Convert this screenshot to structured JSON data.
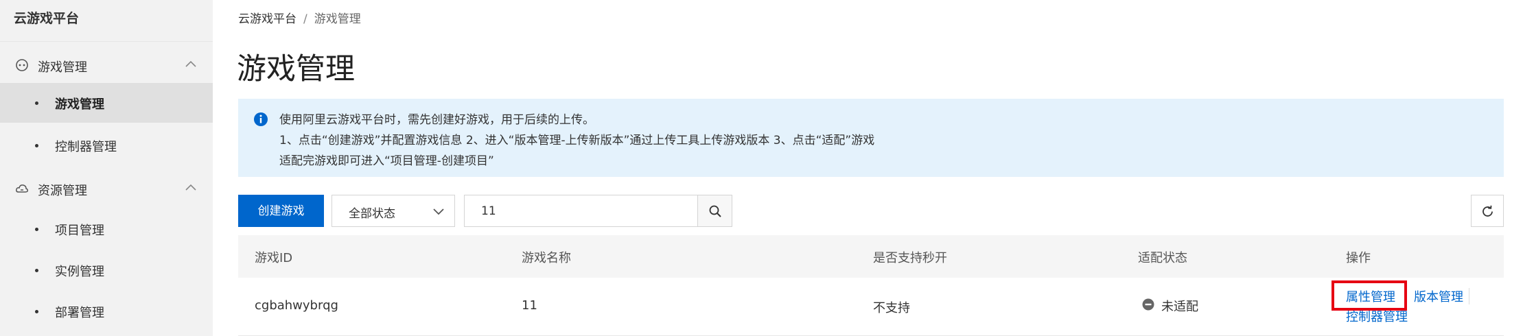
{
  "sidebar": {
    "brand": "云游戏平台",
    "groups": [
      {
        "label": "游戏管理",
        "icon": "gamepad-icon",
        "items": [
          {
            "label": "游戏管理",
            "active": true
          },
          {
            "label": "控制器管理",
            "active": false
          }
        ]
      },
      {
        "label": "资源管理",
        "icon": "cloud-icon",
        "items": [
          {
            "label": "项目管理",
            "active": false
          },
          {
            "label": "实例管理",
            "active": false
          },
          {
            "label": "部署管理",
            "active": false
          }
        ]
      }
    ]
  },
  "breadcrumb": {
    "root": "云游戏平台",
    "separator": "/",
    "current": "游戏管理"
  },
  "page_title": "游戏管理",
  "notice": {
    "icon": "info-icon",
    "lines": [
      "使用阿里云游戏平台时，需先创建好游戏，用于后续的上传。",
      "1、点击“创建游戏”并配置游戏信息 2、进入“版本管理-上传新版本”通过上传工具上传游戏版本 3、点击“适配”游戏",
      "适配完游戏即可进入“项目管理-创建项目”"
    ]
  },
  "toolbar": {
    "create_label": "创建游戏",
    "status_select_value": "全部状态",
    "search_value": "11",
    "search_icon": "search-icon",
    "refresh_icon": "refresh-icon"
  },
  "table": {
    "headers": [
      "游戏ID",
      "游戏名称",
      "是否支持秒开",
      "适配状态",
      "操作"
    ],
    "rows": [
      {
        "id": "cgbahwybrqg",
        "name": "11",
        "instant_start": "不支持",
        "adapt_status": "未适配",
        "actions": [
          "属性管理",
          "版本管理",
          "控制器管理"
        ]
      }
    ]
  },
  "colors": {
    "primary": "#0066cc",
    "notice_bg": "#e4f2fc",
    "sidebar_bg": "#f2f2f2",
    "highlight": "#e60012"
  }
}
